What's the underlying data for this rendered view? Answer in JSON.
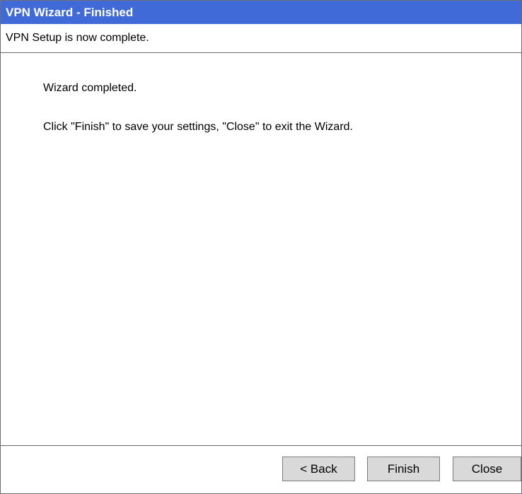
{
  "window": {
    "title": "VPN Wizard - Finished",
    "subtitle": "VPN Setup is now complete."
  },
  "content": {
    "message_1": "Wizard completed.",
    "message_2": "Click \"Finish\" to save your settings, \"Close\" to exit the Wizard."
  },
  "buttons": {
    "back": "< Back",
    "finish": "Finish",
    "close": "Close"
  },
  "colors": {
    "title_bar": "#3f6ad8",
    "title_text": "#ffffff",
    "button_face": "#d9d9d9",
    "border": "#6f6f6f"
  }
}
